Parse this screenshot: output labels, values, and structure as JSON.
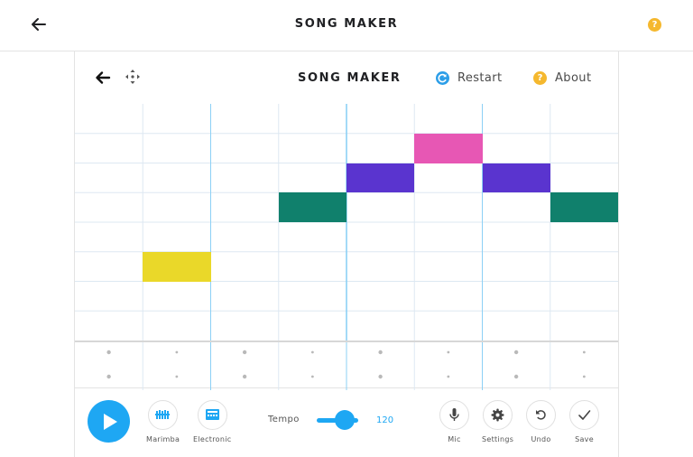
{
  "topbar": {
    "title": "SONG MAKER",
    "help_glyph": "?"
  },
  "app": {
    "title": "SONG MAKER",
    "restart_label": "Restart",
    "about_label": "About",
    "about_glyph": "?"
  },
  "grid": {
    "columns": 8,
    "rows": 8,
    "colors": {
      "grid_line": "#dde8f2",
      "bar_line": "#8cd0f5"
    },
    "notes": [
      {
        "col": 1,
        "row": 5,
        "color": "#ead829"
      },
      {
        "col": 3,
        "row": 3,
        "color": "#10806c"
      },
      {
        "col": 4,
        "row": 2,
        "color": "#5a34cf"
      },
      {
        "col": 5,
        "row": 1,
        "color": "#e757b4"
      },
      {
        "col": 6,
        "row": 2,
        "color": "#5a34cf"
      },
      {
        "col": 7,
        "row": 3,
        "color": "#10806c"
      }
    ]
  },
  "footer": {
    "marimba_label": "Marimba",
    "electronic_label": "Electronic",
    "tempo_label": "Tempo",
    "tempo_value": "120",
    "mic_label": "Mic",
    "settings_label": "Settings",
    "undo_label": "Undo",
    "save_label": "Save"
  },
  "colors": {
    "accent": "#1ea7f3",
    "help": "#f5b82e"
  },
  "icons": [
    "back-arrow-icon",
    "help-icon",
    "move-icon",
    "restart-icon",
    "play-icon",
    "marimba-icon",
    "electronic-icon",
    "mic-icon",
    "gear-icon",
    "undo-icon",
    "checkmark-icon"
  ]
}
